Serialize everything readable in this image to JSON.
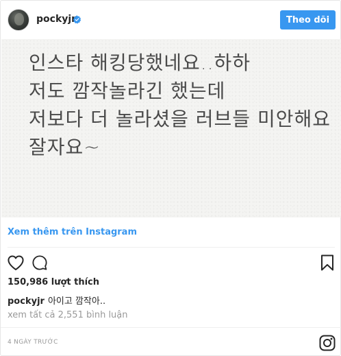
{
  "header": {
    "username": "pockyjr",
    "follow_label": "Theo dõi",
    "verified_color": "#3897f0"
  },
  "photo": {
    "lines": [
      "인스타 해킹당했네요..하하",
      "저도 깜작놀라긴 했는데",
      "저보다 더 놀라셨을 러브들 미안해요",
      "잘자요~"
    ]
  },
  "links": {
    "see_more": "Xem thêm trên Instagram"
  },
  "actions": {
    "icons": [
      "heart-icon",
      "comment-icon",
      "bookmark-icon"
    ]
  },
  "stats": {
    "likes": "150,986 lượt thích"
  },
  "caption": {
    "username": "pockyjr",
    "text": "아이고 깜작아.."
  },
  "comments": {
    "view_all": "xem tất cả 2,551 bình luận"
  },
  "footer": {
    "timestamp": "4 NGÀY TRƯỚC",
    "logo_icon": "instagram-icon"
  },
  "colors": {
    "accent": "#3897f0",
    "text": "#262626",
    "muted": "#999999"
  }
}
